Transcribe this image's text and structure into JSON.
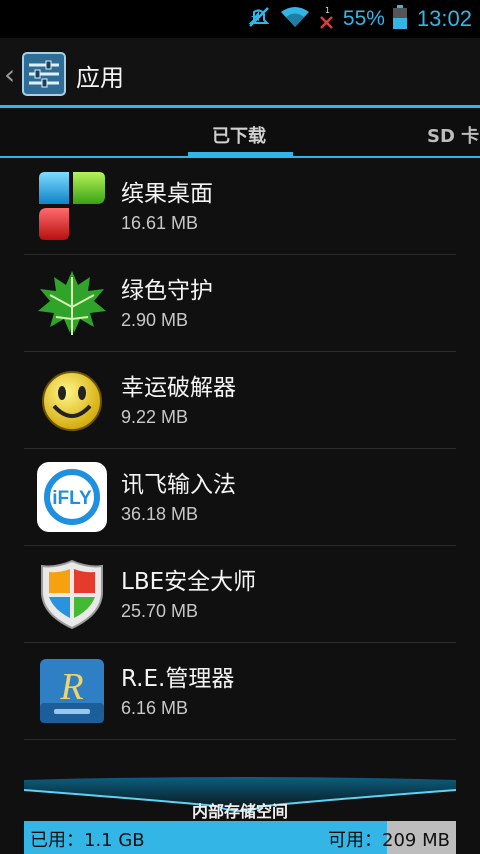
{
  "status_bar": {
    "battery_percent": "55%",
    "time": "13:02",
    "icons": [
      "mute-icon",
      "wifi-icon",
      "no-signal-icon",
      "battery-icon"
    ]
  },
  "action_bar": {
    "title": "应用"
  },
  "tabs": [
    {
      "label": "已下载",
      "active": true
    },
    {
      "label": "SD 卡",
      "active": false
    }
  ],
  "apps": [
    {
      "name": "缤果桌面",
      "size": "16.61 MB",
      "icon": "bingo-desktop-icon"
    },
    {
      "name": "绿色守护",
      "size": "2.90 MB",
      "icon": "greenify-leaf-icon"
    },
    {
      "name": "幸运破解器",
      "size": "9.22 MB",
      "icon": "lucky-patcher-smiley-icon"
    },
    {
      "name": "讯飞输入法",
      "size": "36.18 MB",
      "icon": "ifly-input-icon",
      "icon_text": "iFLY"
    },
    {
      "name": "LBE安全大师",
      "size": "25.70 MB",
      "icon": "lbe-shield-icon"
    },
    {
      "name": "R.E.管理器",
      "size": "6.16 MB",
      "icon": "re-manager-icon",
      "icon_text": "R"
    }
  ],
  "storage": {
    "label": "内部存储空间",
    "used": "已用：1.1 GB",
    "free": "可用：209 MB",
    "used_fraction": 0.84
  },
  "colors": {
    "accent": "#33b5e5",
    "background": "#101010"
  }
}
